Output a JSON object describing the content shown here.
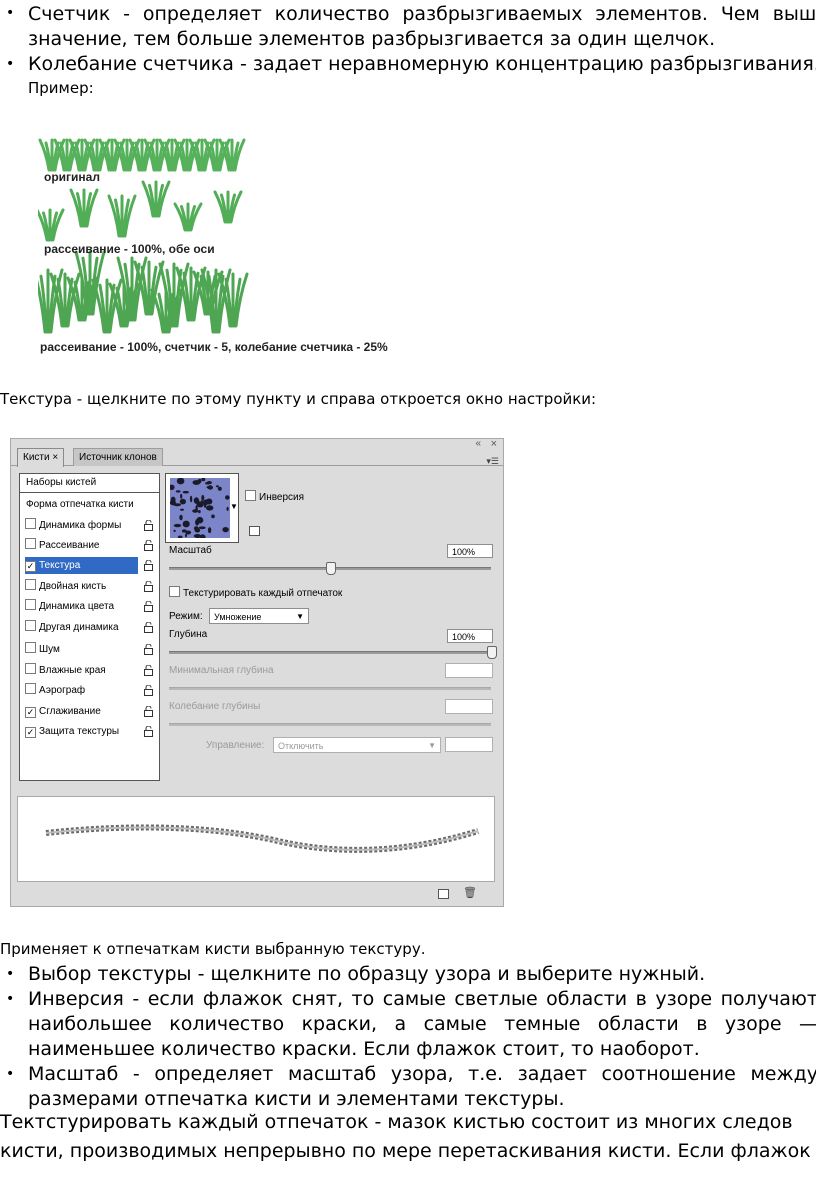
{
  "top_bullets": [
    {
      "text": "Счетчик - определяет количество разбрызгиваемых элементов. Чем выше значение, тем больше элементов разбрызгивается за один щелчок."
    },
    {
      "text": "Колебание счетчика - задает неравномерную концентрацию разбрызгивания."
    }
  ],
  "example_label": "Пример:",
  "figure_labels": {
    "original": "оригинал",
    "scatter": "рассеивание - 100%, обе оси",
    "scatter_count": "рассеивание - 100%, счетчик - 5, колебание счетчика - 25%"
  },
  "texture_intro": "Текстура - щелкните по этому пункту и справа откроется окно настройки:",
  "panel": {
    "tabs": [
      "Кисти ×",
      "Источник клонов"
    ],
    "window_buttons": [
      "«",
      "×"
    ],
    "presets_label": "Наборы кистей",
    "tip_shape_label": "Форма отпечатка кисти",
    "list_items": [
      {
        "label": "Динамика формы",
        "checked": false,
        "selected": false
      },
      {
        "label": "Рассеивание",
        "checked": false,
        "selected": false
      },
      {
        "label": "Текстура",
        "checked": true,
        "selected": true
      },
      {
        "label": "Двойная кисть",
        "checked": false,
        "selected": false
      },
      {
        "label": "Динамика цвета",
        "checked": false,
        "selected": false
      },
      {
        "label": "Другая динамика",
        "checked": false,
        "selected": false
      },
      {
        "label": "Шум",
        "checked": false,
        "selected": false
      },
      {
        "label": "Влажные края",
        "checked": false,
        "selected": false
      },
      {
        "label": "Аэрограф",
        "checked": false,
        "selected": false
      },
      {
        "label": "Сглаживание",
        "checked": true,
        "selected": false
      },
      {
        "label": "Защита текстуры",
        "checked": true,
        "selected": false
      }
    ],
    "invert_label": "Инверсия",
    "scale_label": "Масштаб",
    "scale_value": "100%",
    "texture_each_tip_label": "Текстурировать каждый отпечаток",
    "mode_label": "Режим:",
    "mode_value": "Умножение",
    "depth_label": "Глубина",
    "depth_value": "100%",
    "min_depth_label": "Минимальная глубина",
    "depth_jitter_label": "Колебание глубины",
    "control_label": "Управление:",
    "control_value": "Отключить",
    "colors": {
      "selection": "#316ac5",
      "panel_bg": "#dcdcdc",
      "pattern": "#7b85c8"
    }
  },
  "applies_text": "Применяет к отпечаткам кисти выбранную текстуру.",
  "bottom_bullets": [
    {
      "text": "Выбор текстуры - щелкните по образцу узора и выберите нужный."
    },
    {
      "text": "Инверсия - если флажок снят, то самые светлые области в узоре получают наибольшее количество краски, а самые темные области в узоре — наименьшее количество краски. Если флажок стоит, то наоборот."
    },
    {
      "text": "Масштаб - определяет масштаб узора, т.е. задает соотношение между размерами отпечатка кисти и элементами текстуры."
    }
  ],
  "final_paragraph_line1": "Тектстурировать каждый отпечаток - мазок кистью состоит из многих следов",
  "final_paragraph_line2": "кисти, производимых непрерывно по мере перетаскивания кисти. Если флажок"
}
